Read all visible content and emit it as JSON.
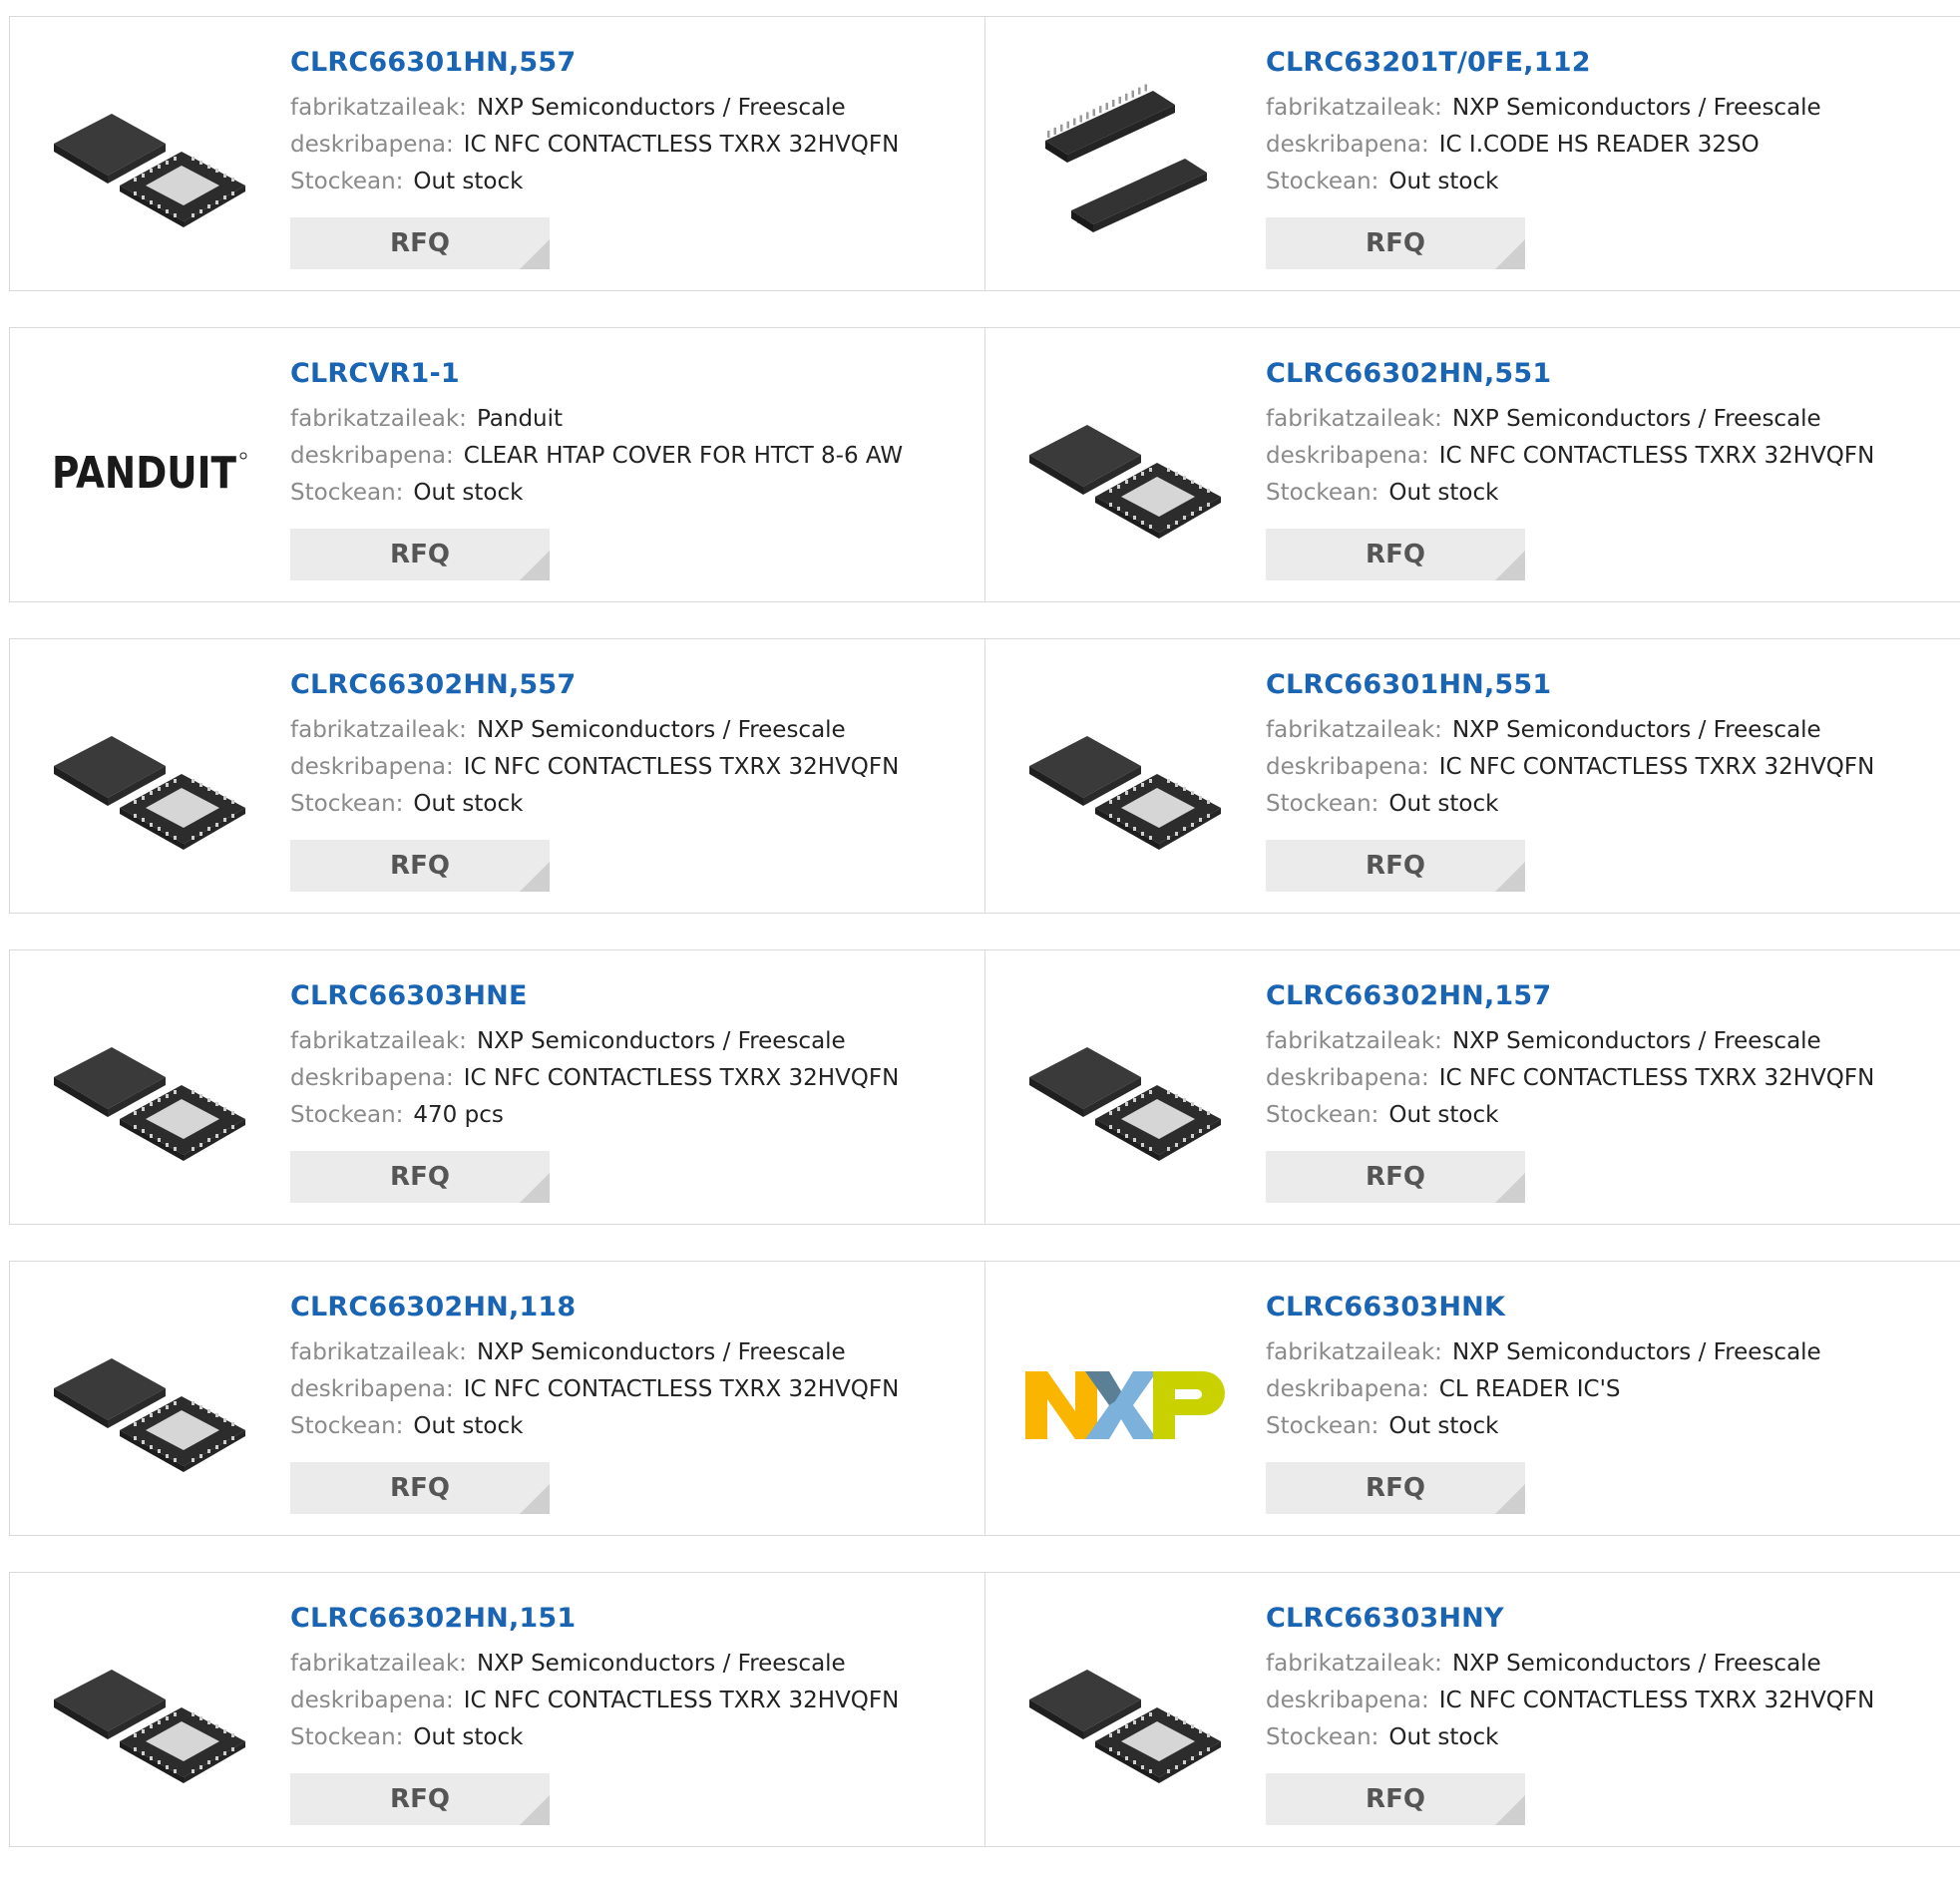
{
  "labels": {
    "manufacturer": "fabrikatzaileak:",
    "description": "deskribapena:",
    "stock": "Stockean:"
  },
  "products": [
    {
      "part": "CLRC66301HN,557",
      "manufacturer": "NXP Semiconductors / Freescale",
      "description": "IC NFC CONTACTLESS TXRX 32HVQFN",
      "stock": "Out stock",
      "rfq": "RFQ",
      "thumb": "qfn-chip-icon"
    },
    {
      "part": "CLRC63201T/0FE,112",
      "manufacturer": "NXP Semiconductors / Freescale",
      "description": "IC I.CODE HS READER 32SO",
      "stock": "Out stock",
      "rfq": "RFQ",
      "thumb": "so-chip-icon"
    },
    {
      "part": "CLRCVR1-1",
      "manufacturer": "Panduit",
      "description": "CLEAR HTAP COVER FOR HTCT 8-6 AW",
      "stock": "Out stock",
      "rfq": "RFQ",
      "thumb": "panduit-logo",
      "logo_text": "PANDUIT"
    },
    {
      "part": "CLRC66302HN,551",
      "manufacturer": "NXP Semiconductors / Freescale",
      "description": "IC NFC CONTACTLESS TXRX 32HVQFN",
      "stock": "Out stock",
      "rfq": "RFQ",
      "thumb": "qfn-chip-icon"
    },
    {
      "part": "CLRC66302HN,557",
      "manufacturer": "NXP Semiconductors / Freescale",
      "description": "IC NFC CONTACTLESS TXRX 32HVQFN",
      "stock": "Out stock",
      "rfq": "RFQ",
      "thumb": "qfn-chip-icon"
    },
    {
      "part": "CLRC66301HN,551",
      "manufacturer": "NXP Semiconductors / Freescale",
      "description": "IC NFC CONTACTLESS TXRX 32HVQFN",
      "stock": "Out stock",
      "rfq": "RFQ",
      "thumb": "qfn-chip-icon"
    },
    {
      "part": "CLRC66303HNE",
      "manufacturer": "NXP Semiconductors / Freescale",
      "description": "IC NFC CONTACTLESS TXRX 32HVQFN",
      "stock": "470 pcs",
      "rfq": "RFQ",
      "thumb": "qfn-chip-icon"
    },
    {
      "part": "CLRC66302HN,157",
      "manufacturer": "NXP Semiconductors / Freescale",
      "description": "IC NFC CONTACTLESS TXRX 32HVQFN",
      "stock": "Out stock",
      "rfq": "RFQ",
      "thumb": "qfn-chip-icon"
    },
    {
      "part": "CLRC66302HN,118",
      "manufacturer": "NXP Semiconductors / Freescale",
      "description": "IC NFC CONTACTLESS TXRX 32HVQFN",
      "stock": "Out stock",
      "rfq": "RFQ",
      "thumb": "qfn-chip-icon"
    },
    {
      "part": "CLRC66303HNK",
      "manufacturer": "NXP Semiconductors / Freescale",
      "description": "CL READER IC'S",
      "stock": "Out stock",
      "rfq": "RFQ",
      "thumb": "nxp-logo",
      "logo_text": "NXP"
    },
    {
      "part": "CLRC66302HN,151",
      "manufacturer": "NXP Semiconductors / Freescale",
      "description": "IC NFC CONTACTLESS TXRX 32HVQFN",
      "stock": "Out stock",
      "rfq": "RFQ",
      "thumb": "qfn-chip-icon"
    },
    {
      "part": "CLRC66303HNY",
      "manufacturer": "NXP Semiconductors / Freescale",
      "description": "IC NFC CONTACTLESS TXRX 32HVQFN",
      "stock": "Out stock",
      "rfq": "RFQ",
      "thumb": "qfn-chip-icon"
    }
  ],
  "colors": {
    "part_link": "#1a64b4",
    "label": "#8a8a8a",
    "value": "#222222",
    "rfq_bg": "#ebebeb",
    "nxp_yellow": "#f9b500",
    "nxp_blue": "#7bb1db",
    "nxp_green": "#c9d200"
  }
}
